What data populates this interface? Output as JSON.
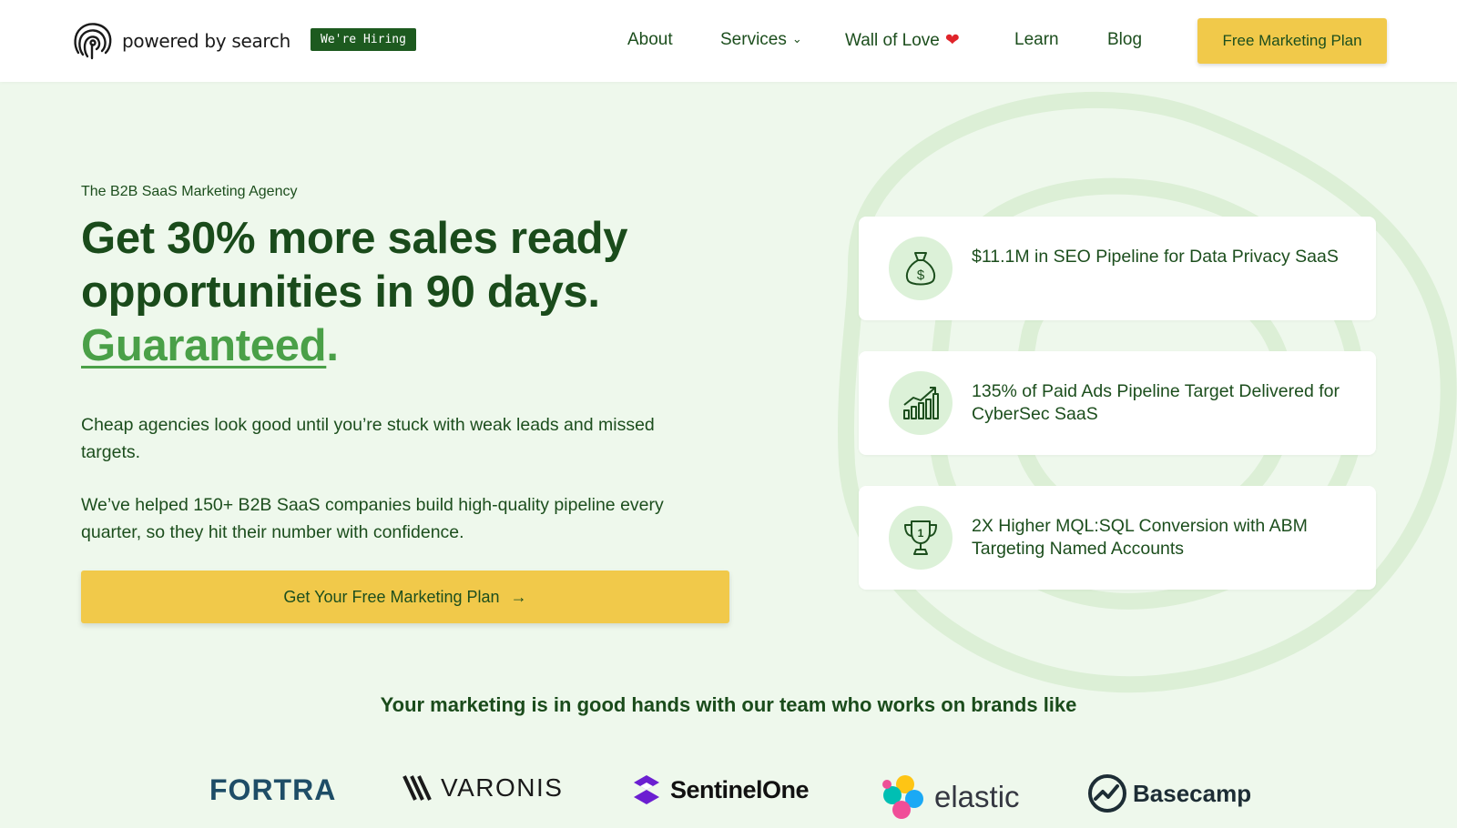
{
  "header": {
    "logo_text": "powered by search",
    "hiring_badge": "We're Hiring",
    "nav": [
      {
        "label": "About"
      },
      {
        "label": "Services"
      },
      {
        "label": "Wall of Love"
      },
      {
        "label": "Learn"
      },
      {
        "label": "Blog"
      }
    ],
    "cta_label": "Free Marketing Plan"
  },
  "hero": {
    "eyebrow": "The B2B SaaS Marketing Agency",
    "headline_line1": "Get 30% more sales ready",
    "headline_line2": "opportunities in 90 days.",
    "headline_accent": "Guaranteed",
    "headline_period": ".",
    "paragraph1": "Cheap agencies look good until you’re stuck with weak leads and missed targets.",
    "paragraph2": "We’ve helped 150+ B2B SaaS companies build high-quality pipeline every quarter, so they hit their number with confidence.",
    "cta_label": "Get Your Free Marketing Plan",
    "cta_arrow": "→"
  },
  "results": [
    {
      "icon": "money-bag-icon",
      "text": "$11.1M in SEO Pipeline for Data Privacy SaaS"
    },
    {
      "icon": "bar-chart-growth-icon",
      "text": "135% of Paid Ads Pipeline Target Delivered for CyberSec SaaS"
    },
    {
      "icon": "trophy-icon",
      "text": "2X Higher MQL:SQL Conversion with ABM Targeting Named Accounts"
    }
  ],
  "brands": {
    "title": "Your marketing is in good hands with our team who works on brands like",
    "logos": [
      "FORTRA",
      "VARONIS",
      "SentinelOne",
      "elastic",
      "Basecamp"
    ]
  },
  "colors": {
    "accent_yellow": "#f1c94a",
    "brand_green": "#1a4b1b",
    "accent_green": "#4aa048",
    "background": "#eef8ec"
  }
}
